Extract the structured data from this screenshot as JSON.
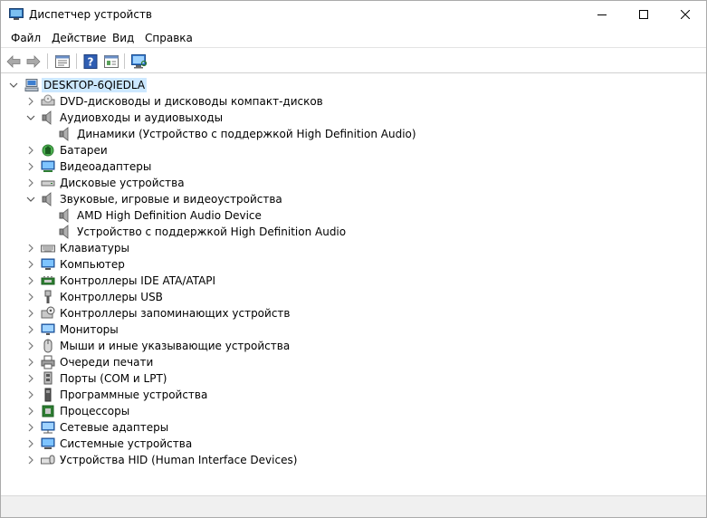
{
  "window": {
    "title": "Диспетчер устройств"
  },
  "menu": [
    "Файл",
    "Действие",
    "Вид",
    "Справка"
  ],
  "toolbar": [
    "back-arrow-icon",
    "forward-arrow-icon",
    "properties-icon",
    "help-icon",
    "view-icon",
    "monitor-scan-icon"
  ],
  "tree": {
    "root": "DESKTOP-6QIEDLA",
    "items": [
      {
        "label": "DVD-дисководы и дисководы компакт-дисков",
        "icon": "dvd-drive-icon",
        "expanded": false,
        "level": 1
      },
      {
        "label": "Аудиовходы и аудиовыходы",
        "icon": "speaker-icon",
        "expanded": true,
        "level": 1
      },
      {
        "label": "Динамики (Устройство с поддержкой High Definition Audio)",
        "icon": "speaker-icon",
        "level": 2
      },
      {
        "label": "Батареи",
        "icon": "battery-icon",
        "expanded": false,
        "level": 1
      },
      {
        "label": "Видеоадаптеры",
        "icon": "display-adapter-icon",
        "expanded": false,
        "level": 1
      },
      {
        "label": "Дисковые устройства",
        "icon": "disk-drive-icon",
        "expanded": false,
        "level": 1
      },
      {
        "label": "Звуковые, игровые и видеоустройства",
        "icon": "speaker-icon",
        "expanded": true,
        "level": 1
      },
      {
        "label": "AMD High Definition Audio Device",
        "icon": "speaker-icon",
        "level": 2
      },
      {
        "label": "Устройство с поддержкой High Definition Audio",
        "icon": "speaker-icon",
        "level": 2
      },
      {
        "label": "Клавиатуры",
        "icon": "keyboard-icon",
        "expanded": false,
        "level": 1
      },
      {
        "label": "Компьютер",
        "icon": "computer-icon",
        "expanded": false,
        "level": 1
      },
      {
        "label": "Контроллеры IDE ATA/ATAPI",
        "icon": "ide-controller-icon",
        "expanded": false,
        "level": 1
      },
      {
        "label": "Контроллеры USB",
        "icon": "usb-icon",
        "expanded": false,
        "level": 1
      },
      {
        "label": "Контроллеры запоминающих устройств",
        "icon": "storage-controller-icon",
        "expanded": false,
        "level": 1
      },
      {
        "label": "Мониторы",
        "icon": "monitor-icon",
        "expanded": false,
        "level": 1
      },
      {
        "label": "Мыши и иные указывающие устройства",
        "icon": "mouse-icon",
        "expanded": false,
        "level": 1
      },
      {
        "label": "Очереди печати",
        "icon": "printer-icon",
        "expanded": false,
        "level": 1
      },
      {
        "label": "Порты (COM и LPT)",
        "icon": "port-icon",
        "expanded": false,
        "level": 1
      },
      {
        "label": "Программные устройства",
        "icon": "software-device-icon",
        "expanded": false,
        "level": 1
      },
      {
        "label": "Процессоры",
        "icon": "processor-icon",
        "expanded": false,
        "level": 1
      },
      {
        "label": "Сетевые адаптеры",
        "icon": "network-adapter-icon",
        "expanded": false,
        "level": 1
      },
      {
        "label": "Системные устройства",
        "icon": "system-device-icon",
        "expanded": false,
        "level": 1
      },
      {
        "label": "Устройства HID (Human Interface Devices)",
        "icon": "hid-icon",
        "expanded": false,
        "level": 1
      }
    ]
  },
  "colors": {
    "selection": "#cce8ff",
    "accent": "#1e73be"
  }
}
